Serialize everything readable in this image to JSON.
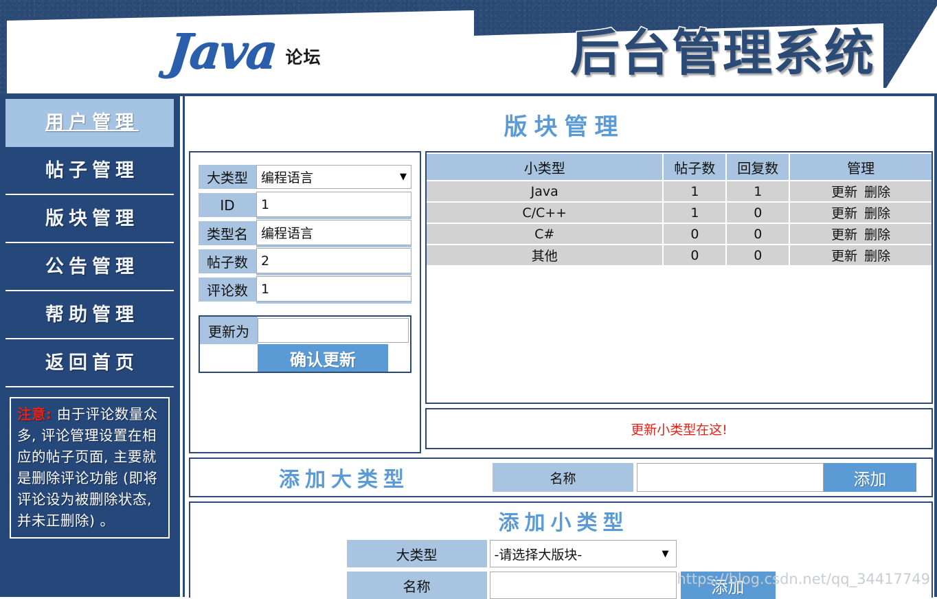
{
  "header": {
    "logo_text": "Java",
    "logo_sub": "论坛",
    "title": "后台管理系统"
  },
  "sidebar": {
    "items": [
      {
        "label": "用户管理",
        "active": true
      },
      {
        "label": "帖子管理",
        "active": false
      },
      {
        "label": "版块管理",
        "active": false
      },
      {
        "label": "公告管理",
        "active": false
      },
      {
        "label": "帮助管理",
        "active": false
      },
      {
        "label": "返回首页",
        "active": false
      }
    ],
    "notice": {
      "label": "注意:",
      "text": " 由于评论数量众多, 评论管理设置在相应的帖子页面, 主要就是删除评论功能 (即将评论设为被删除状态, 并未正删除) 。"
    }
  },
  "main": {
    "page_title": "版块管理",
    "form": {
      "rows": [
        {
          "label": "大类型",
          "value": "编程语言",
          "type": "select"
        },
        {
          "label": "ID",
          "value": "1",
          "type": "text"
        },
        {
          "label": "类型名",
          "value": "编程语言",
          "type": "text"
        },
        {
          "label": "帖子数",
          "value": "2",
          "type": "text"
        },
        {
          "label": "评论数",
          "value": "1",
          "type": "text"
        }
      ],
      "update_label": "更新为",
      "update_value": "",
      "update_button": "确认更新"
    },
    "table": {
      "headers": [
        "小类型",
        "帖子数",
        "回复数",
        "管理"
      ],
      "action_update": "更新",
      "action_delete": "删除",
      "rows": [
        {
          "name": "Java",
          "posts": "1",
          "replies": "1"
        },
        {
          "name": "C/C++",
          "posts": "1",
          "replies": "0"
        },
        {
          "name": "C#",
          "posts": "0",
          "replies": "0"
        },
        {
          "name": "其他",
          "posts": "0",
          "replies": "0"
        }
      ]
    },
    "hint": "更新小类型在这!",
    "add_big": {
      "title": "添加大类型",
      "name_label": "名称",
      "name_value": "",
      "button": "添加"
    },
    "add_small": {
      "title": "添加小类型",
      "bigtype_label": "大类型",
      "bigtype_value": "-请选择大版块-",
      "name_label": "名称",
      "name_value": "",
      "button": "添加"
    }
  },
  "watermark": "https://blog.csdn.net/qq_34417749",
  "colors": {
    "navy": "#25477a",
    "accent_blue": "#5b9bd5",
    "label_blue": "#a8c4e0",
    "row_gray": "#d2d2d2",
    "red": "#e32219"
  }
}
